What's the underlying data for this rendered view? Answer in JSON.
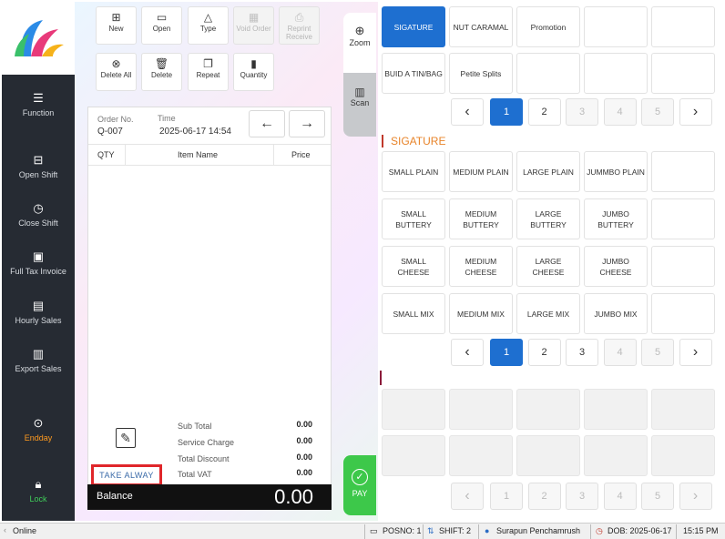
{
  "sidebar": {
    "items": [
      {
        "label": "Function",
        "icon": "menu-icon"
      },
      {
        "label": "Open Shift",
        "icon": "register-icon"
      },
      {
        "label": "Close Shift",
        "icon": "clock-icon"
      },
      {
        "label": "Full Tax Invoice",
        "icon": "clipboard-icon"
      },
      {
        "label": "Hourly Sales",
        "icon": "document-icon"
      },
      {
        "label": "Export Sales",
        "icon": "txt-file-icon"
      },
      {
        "label": "Endday",
        "icon": "pin-icon"
      },
      {
        "label": "Lock",
        "icon": "lock-icon"
      }
    ]
  },
  "toolbar": {
    "new": "New",
    "open": "Open",
    "type": "Type",
    "void_order": "Void Order",
    "reprint_receive": "Reprint Receive",
    "delete_all": "Delete All",
    "delete": "Delete",
    "repeat": "Repeat",
    "quantity": "Quantity"
  },
  "order": {
    "order_no_label": "Order No.",
    "order_no": "Q-007",
    "time_label": "Time",
    "time": "2025-06-17 14:54",
    "col_qty": "QTY",
    "col_item": "Item Name",
    "col_price": "Price",
    "sub_total_label": "Sub Total",
    "sub_total": "0.00",
    "service_charge_label": "Service Charge",
    "service_charge": "0.00",
    "total_discount_label": "Total Discount",
    "total_discount": "0.00",
    "total_vat_label": "Total VAT",
    "total_vat": "0.00",
    "take_away": "TAKE ALWAY",
    "balance_label": "Balance",
    "balance": "0.00"
  },
  "side_buttons": {
    "zoom": "Zoom",
    "scan": "Scan",
    "pay": "PAY"
  },
  "categories": [
    "SIGATURE",
    "NUT CARAMAL",
    "Promotion",
    "",
    "",
    "BUID A TIN/BAG",
    "Petite Splits",
    "",
    "",
    ""
  ],
  "category_pages": [
    "1",
    "2",
    "3",
    "4",
    "5"
  ],
  "section_title": "SIGATURE",
  "products": [
    "SMALL PLAIN",
    "MEDIUM PLAIN",
    "LARGE PLAIN",
    "JUMMBO PLAIN",
    "",
    "SMALL BUTTERY",
    "MEDIUM BUTTERY",
    "LARGE BUTTERY",
    "JUMBO BUTTERY",
    "",
    "SMALL CHEESE",
    "MEDIUM CHEESE",
    "LARGE CHEESE",
    "JUMBO CHEESE",
    "",
    "SMALL MIX",
    "MEDIUM MIX",
    "LARGE MIX",
    "JUMBO MIX",
    ""
  ],
  "product_pages": [
    "1",
    "2",
    "3",
    "4",
    "5"
  ],
  "bottom_pages": [
    "1",
    "2",
    "3",
    "4",
    "5"
  ],
  "status": {
    "online": "Online",
    "posno": "POSNO: 1",
    "shift": "SHIFT: 2",
    "user": "Surapun Penchamrush",
    "dob": "DOB: 2025-06-17",
    "time": "15:15 PM"
  },
  "colors": {
    "accent": "#1e6fd0",
    "sidebar": "#262b33",
    "section": "#e8842a",
    "pay": "#3dc84a",
    "highlight": "#e0262a"
  }
}
